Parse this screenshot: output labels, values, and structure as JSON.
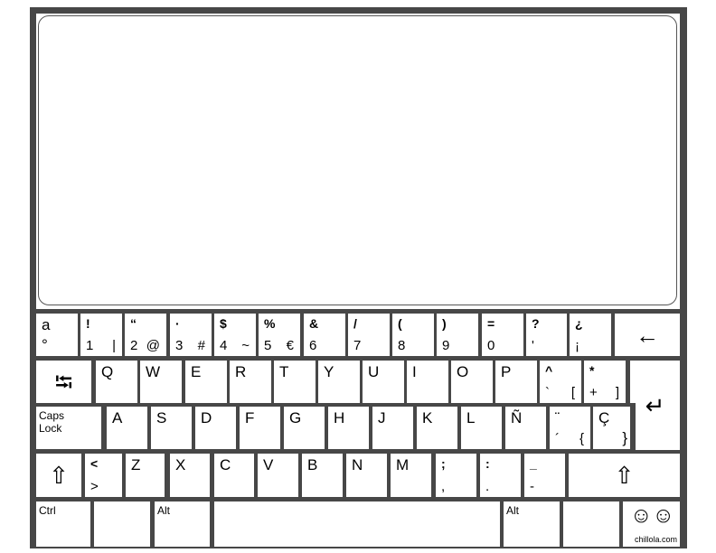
{
  "keyboard": {
    "rows": [
      [
        {
          "name": "key-a-degree",
          "tl": "a",
          "bl": "°"
        },
        {
          "name": "key-1",
          "tl": "!",
          "bl": "1",
          "br": "|"
        },
        {
          "name": "key-2",
          "tl": "“",
          "bl": "2",
          "br": "@"
        },
        {
          "name": "key-3",
          "tl": "·",
          "bl": "3",
          "br": "#"
        },
        {
          "name": "key-4",
          "tl": "$",
          "bl": "4",
          "br": "~"
        },
        {
          "name": "key-5",
          "tl": "%",
          "bl": "5",
          "br": "€"
        },
        {
          "name": "key-6",
          "tl": "&",
          "bl": "6"
        },
        {
          "name": "key-7",
          "tl": "/",
          "bl": "7"
        },
        {
          "name": "key-8",
          "tl": "(",
          "bl": "8"
        },
        {
          "name": "key-9",
          "tl": ")",
          "bl": "9"
        },
        {
          "name": "key-0",
          "tl": "=",
          "bl": "0"
        },
        {
          "name": "key-question",
          "tl": "?",
          "bl": "'"
        },
        {
          "name": "key-inverted-question",
          "tl": "¿",
          "bl": "¡"
        },
        {
          "name": "key-backspace",
          "icon": "backspace-arrow-icon",
          "glyph": "←"
        }
      ],
      [
        {
          "name": "key-tab",
          "icon": "tab-icon",
          "glyph": "⭾"
        },
        {
          "name": "key-q",
          "tl": "Q"
        },
        {
          "name": "key-w",
          "tl": "W"
        },
        {
          "name": "key-e",
          "tl": "E"
        },
        {
          "name": "key-r",
          "tl": "R"
        },
        {
          "name": "key-t",
          "tl": "T"
        },
        {
          "name": "key-y",
          "tl": "Y"
        },
        {
          "name": "key-u",
          "tl": "U"
        },
        {
          "name": "key-i",
          "tl": "I"
        },
        {
          "name": "key-o",
          "tl": "O"
        },
        {
          "name": "key-p",
          "tl": "P"
        },
        {
          "name": "key-caret",
          "tl": "^",
          "bl": "`",
          "br": "["
        },
        {
          "name": "key-plus",
          "tl": "*",
          "bl": "+",
          "br": "]"
        },
        {
          "name": "key-enter",
          "icon": "enter-icon",
          "glyph": "↵"
        }
      ],
      [
        {
          "name": "key-caps-lock",
          "tl": "Caps",
          "bl": "Lock"
        },
        {
          "name": "key-a",
          "tl": "A"
        },
        {
          "name": "key-s",
          "tl": "S"
        },
        {
          "name": "key-d",
          "tl": "D"
        },
        {
          "name": "key-f",
          "tl": "F"
        },
        {
          "name": "key-g",
          "tl": "G"
        },
        {
          "name": "key-h",
          "tl": "H"
        },
        {
          "name": "key-j",
          "tl": "J"
        },
        {
          "name": "key-k",
          "tl": "K"
        },
        {
          "name": "key-l",
          "tl": "L"
        },
        {
          "name": "key-enye",
          "tl": "Ñ"
        },
        {
          "name": "key-diaeresis",
          "tl": "¨",
          "bl": "´",
          "br": "{"
        },
        {
          "name": "key-cedilla",
          "tl": "Ç",
          "br": "}"
        }
      ],
      [
        {
          "name": "key-left-shift",
          "icon": "shift-icon",
          "glyph": "⇧"
        },
        {
          "name": "key-less-greater",
          "tl": "<",
          "bl": ">"
        },
        {
          "name": "key-z",
          "tl": "Z"
        },
        {
          "name": "key-x",
          "tl": "X"
        },
        {
          "name": "key-c",
          "tl": "C"
        },
        {
          "name": "key-v",
          "tl": "V"
        },
        {
          "name": "key-b",
          "tl": "B"
        },
        {
          "name": "key-n",
          "tl": "N"
        },
        {
          "name": "key-m",
          "tl": "M"
        },
        {
          "name": "key-semicolon",
          "tl": ";",
          "bl": ","
        },
        {
          "name": "key-colon",
          "tl": ":",
          "bl": "."
        },
        {
          "name": "key-underscore",
          "tl": "_",
          "bl": "-"
        },
        {
          "name": "key-right-shift",
          "icon": "shift-icon",
          "glyph": "⇧"
        }
      ],
      [
        {
          "name": "key-ctrl",
          "tl": "Ctrl"
        },
        {
          "name": "key-blank-left",
          "tl": ""
        },
        {
          "name": "key-alt",
          "tl": "Alt"
        },
        {
          "name": "key-space",
          "tl": ""
        },
        {
          "name": "key-alt-gr",
          "tl": "Alt"
        },
        {
          "name": "key-blank-right",
          "tl": ""
        },
        {
          "name": "key-logo",
          "logo": "chillola.com",
          "icon": "chillola-faces-logo-icon",
          "glyph": "☺☺"
        }
      ]
    ]
  }
}
